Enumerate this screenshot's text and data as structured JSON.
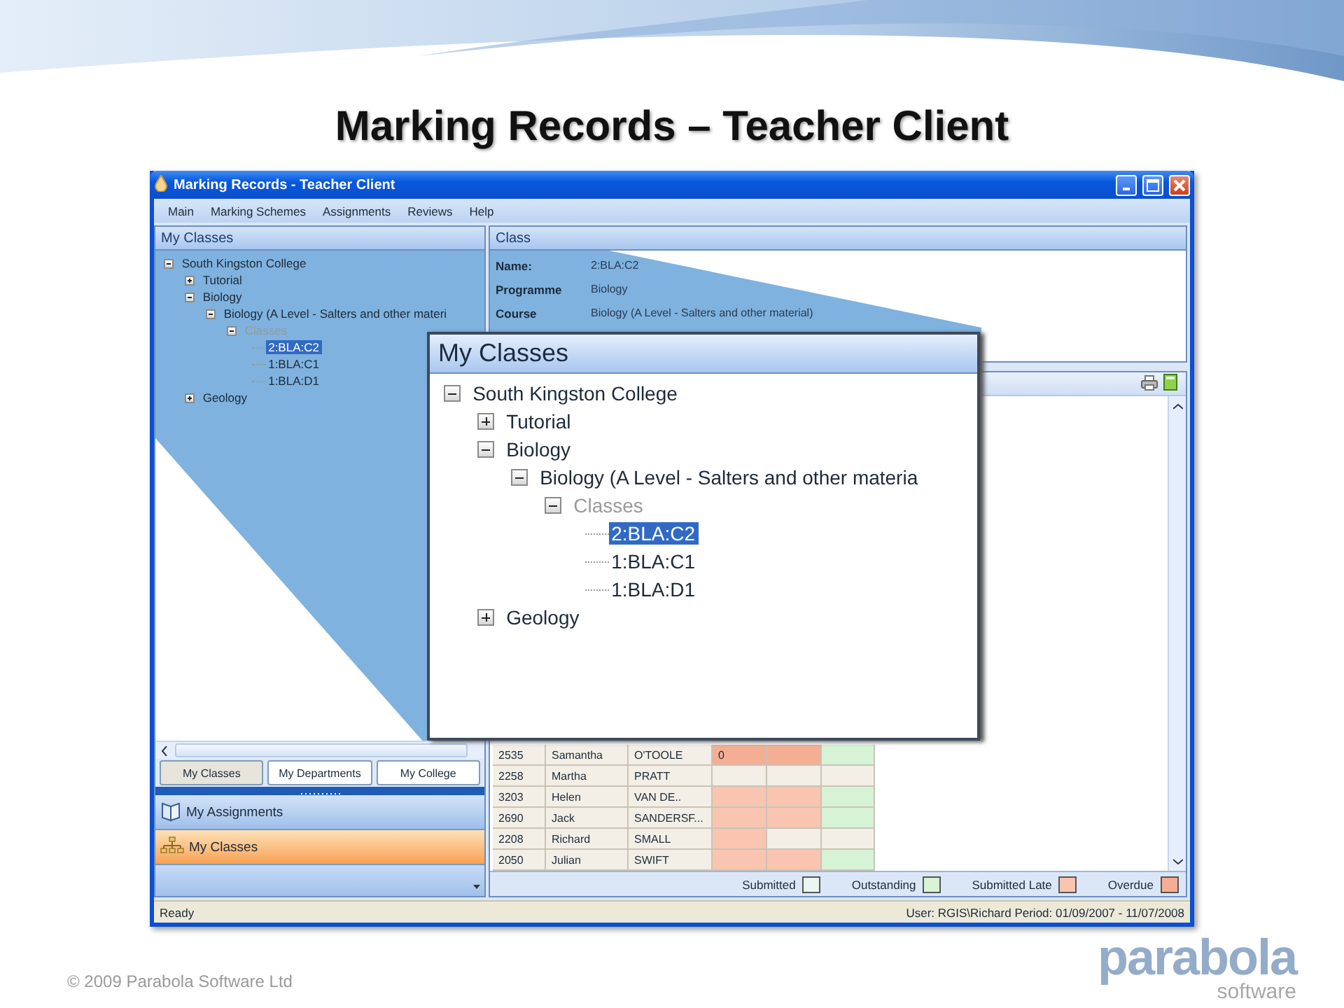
{
  "slide": {
    "title": "Marking Records – Teacher Client",
    "copyright": "© 2009 Parabola Software Ltd",
    "logo": {
      "name": "parabola",
      "tagline": "software"
    }
  },
  "window": {
    "title": "Marking Records - Teacher Client",
    "menu": [
      "Main",
      "Marking Schemes",
      "Assignments",
      "Reviews",
      "Help"
    ]
  },
  "left_panel": {
    "header": "My Classes",
    "tree": [
      {
        "label": "South Kingston College",
        "kind": "group",
        "expanded": true,
        "selected": false,
        "disabled": false,
        "children": [
          {
            "label": "Tutorial",
            "kind": "group",
            "expanded": false,
            "selected": false,
            "disabled": false
          },
          {
            "label": "Biology",
            "kind": "group",
            "expanded": true,
            "selected": false,
            "disabled": false,
            "children": [
              {
                "label": "Biology (A Level - Salters and other materi",
                "kind": "group",
                "expanded": true,
                "selected": false,
                "disabled": false,
                "children": [
                  {
                    "label": "Classes",
                    "kind": "group",
                    "expanded": true,
                    "selected": false,
                    "disabled": true,
                    "children": [
                      {
                        "label": "2:BLA:C2",
                        "kind": "leaf",
                        "selected": true,
                        "disabled": false
                      },
                      {
                        "label": "1:BLA:C1",
                        "kind": "leaf",
                        "selected": false,
                        "disabled": false
                      },
                      {
                        "label": "1:BLA:D1",
                        "kind": "leaf",
                        "selected": false,
                        "disabled": false
                      }
                    ]
                  }
                ]
              }
            ]
          },
          {
            "label": "Geology",
            "kind": "group",
            "expanded": false,
            "selected": false,
            "disabled": false
          }
        ]
      }
    ],
    "view_buttons": [
      {
        "label": "My Classes",
        "selected": true
      },
      {
        "label": "My Departments",
        "selected": false
      },
      {
        "label": "My College",
        "selected": false
      }
    ],
    "nav": [
      {
        "label": "My Assignments",
        "selected": false
      },
      {
        "label": "My Classes",
        "selected": true
      }
    ]
  },
  "class_panel": {
    "header": "Class",
    "fields": [
      {
        "label": "Name:",
        "value": "2:BLA:C2"
      },
      {
        "label": "Programme",
        "value": "Biology"
      },
      {
        "label": "Course",
        "value": "Biology (A Level - Salters and other material)"
      }
    ]
  },
  "grid": {
    "rows": [
      {
        "cells": [
          "2535",
          "Samantha",
          "O'TOOLE"
        ],
        "status": [
          {
            "color": "#f4ae94",
            "text": "0"
          },
          {
            "color": "#f4ae94"
          },
          {
            "color": "#d6f3d6"
          }
        ]
      },
      {
        "cells": [
          "2258",
          "Martha",
          "PRATT"
        ],
        "status": [
          {
            "color": "#f3efe6"
          },
          {
            "color": "#f3efe6"
          },
          {
            "color": "#f3efe6"
          }
        ]
      },
      {
        "cells": [
          "3203",
          "Helen",
          "VAN DE.."
        ],
        "status": [
          {
            "color": "#f9c5b0"
          },
          {
            "color": "#f9c5b0"
          },
          {
            "color": "#d6f3d6"
          }
        ]
      },
      {
        "cells": [
          "2690",
          "Jack",
          "SANDERSF..."
        ],
        "status": [
          {
            "color": "#f9c5b0"
          },
          {
            "color": "#f9c5b0"
          },
          {
            "color": "#d6f3d6"
          }
        ]
      },
      {
        "cells": [
          "2208",
          "Richard",
          "SMALL"
        ],
        "status": [
          {
            "color": "#f9c5b0"
          },
          {
            "color": "#f3efe6"
          },
          {
            "color": "#f3efe6"
          }
        ]
      },
      {
        "cells": [
          "2050",
          "Julian",
          "SWIFT"
        ],
        "status": [
          {
            "color": "#f9c5b0"
          },
          {
            "color": "#f9c5b0"
          },
          {
            "color": "#d6f3d6"
          }
        ]
      }
    ],
    "legend": [
      {
        "label": "Submitted",
        "color": "#eaf6f1"
      },
      {
        "label": "Outstanding",
        "color": "#d6f3d6"
      },
      {
        "label": "Submitted Late",
        "color": "#f9c5b0"
      },
      {
        "label": "Overdue",
        "color": "#f4ae94"
      }
    ]
  },
  "status_bar": {
    "left": "Ready",
    "right": "User: RGIS\\Richard  Period: 01/09/2007 - 11/07/2008"
  },
  "callout": {
    "header": "My Classes",
    "tree": [
      {
        "label": "South Kingston College",
        "kind": "group",
        "expanded": true,
        "selected": false,
        "disabled": false,
        "children": [
          {
            "label": "Tutorial",
            "kind": "group",
            "expanded": false,
            "selected": false,
            "disabled": false
          },
          {
            "label": "Biology",
            "kind": "group",
            "expanded": true,
            "selected": false,
            "disabled": false,
            "children": [
              {
                "label": "Biology (A Level - Salters and other materia",
                "kind": "group",
                "expanded": true,
                "selected": false,
                "disabled": false,
                "children": [
                  {
                    "label": "Classes",
                    "kind": "group",
                    "expanded": true,
                    "selected": false,
                    "disabled": true,
                    "children": [
                      {
                        "label": "2:BLA:C2",
                        "kind": "leaf",
                        "selected": true,
                        "disabled": false
                      },
                      {
                        "label": "1:BLA:C1",
                        "kind": "leaf",
                        "selected": false,
                        "disabled": false
                      },
                      {
                        "label": "1:BLA:D1",
                        "kind": "leaf",
                        "selected": false,
                        "disabled": false
                      }
                    ]
                  }
                ]
              }
            ]
          },
          {
            "label": "Geology",
            "kind": "group",
            "expanded": false,
            "selected": false,
            "disabled": false
          }
        ]
      }
    ]
  }
}
